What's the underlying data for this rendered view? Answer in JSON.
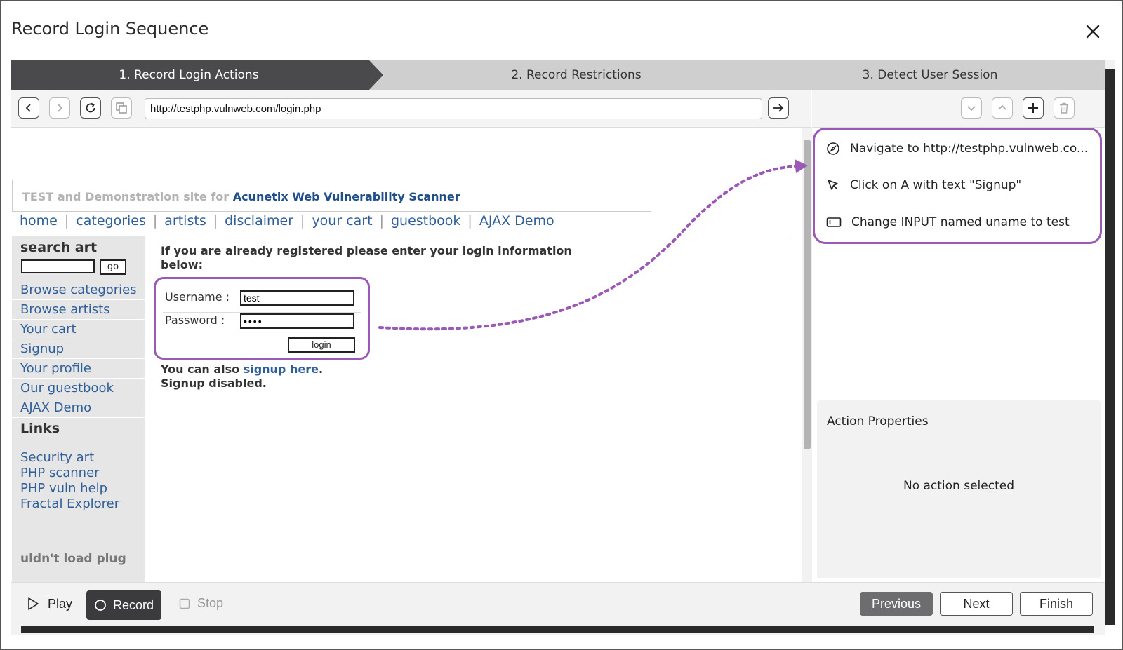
{
  "dialog": {
    "title": "Record Login Sequence"
  },
  "steps": [
    {
      "label": "1. Record Login Actions"
    },
    {
      "label": "2. Record Restrictions"
    },
    {
      "label": "3. Detect User Session"
    }
  ],
  "browser": {
    "url": "http://testphp.vulnweb.com/login.php"
  },
  "site": {
    "banner_lead": "TEST and Demonstration site for ",
    "banner_brand": "Acunetix Web Vulnerability Scanner",
    "nav": [
      "home",
      "categories",
      "artists",
      "disclaimer",
      "your cart",
      "guestbook",
      "AJAX Demo"
    ],
    "search_heading": "search art",
    "go_label": "go",
    "side_menu": [
      "Browse categories",
      "Browse artists",
      "Your cart",
      "Signup",
      "Your profile",
      "Our guestbook",
      "AJAX Demo"
    ],
    "links_heading": "Links",
    "links": [
      "Security art",
      "PHP scanner",
      "PHP vuln help",
      "Fractal Explorer"
    ],
    "plugin_text": "uldn't load plug",
    "login_intro": "If you are already registered please enter your login information below:",
    "username_label": "Username :",
    "username_value": "test",
    "password_label": "Password :",
    "password_value": "••••",
    "login_button": "login",
    "also_text": "You can also ",
    "signup_link": "signup here",
    "signup_disabled": "Signup disabled."
  },
  "actions": [
    {
      "icon": "compass-icon",
      "text": "Navigate to http://testphp.vulnweb.co..."
    },
    {
      "icon": "cursor-icon",
      "text": "Click on A with text \"Signup\""
    },
    {
      "icon": "input-field-icon",
      "text": "Change INPUT named uname to test"
    }
  ],
  "properties": {
    "title": "Action Properties",
    "empty": "No action selected"
  },
  "controls": {
    "play": "Play",
    "record": "Record",
    "stop": "Stop",
    "previous": "Previous",
    "next": "Next",
    "finish": "Finish"
  },
  "colors": {
    "highlight": "#9b59b6",
    "active_step": "#4a4a4c",
    "link": "#2f5f99"
  }
}
